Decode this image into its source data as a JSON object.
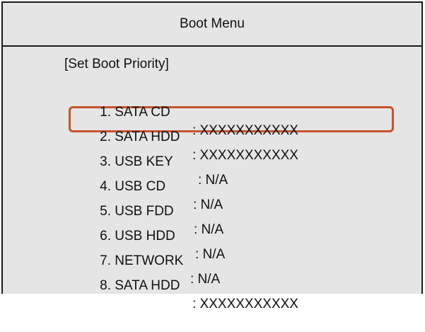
{
  "title": "Boot Menu",
  "section_title": "[Set Boot Priority]",
  "items": [
    {
      "label": "1. SATA CD",
      "value": ": XXXXXXXXXXX"
    },
    {
      "label": "2. SATA HDD",
      "value": ": XXXXXXXXXXX"
    },
    {
      "label": "3. USB KEY",
      "value": ": N/A"
    },
    {
      "label": "4. USB CD",
      "value": ": N/A"
    },
    {
      "label": "5. USB FDD",
      "value": ": N/A"
    },
    {
      "label": "6. USB HDD",
      "value": ": N/A"
    },
    {
      "label": "7. NETWORK",
      "value": ": N/A"
    },
    {
      "label": "8. SATA HDD",
      "value": ": XXXXXXXXXXX"
    }
  ],
  "selected_item": "2. SATA HDD",
  "colors": {
    "background": "#e5e5e5",
    "border": "#1a1a1a",
    "highlight": "#c8532b",
    "text": "#111111"
  }
}
